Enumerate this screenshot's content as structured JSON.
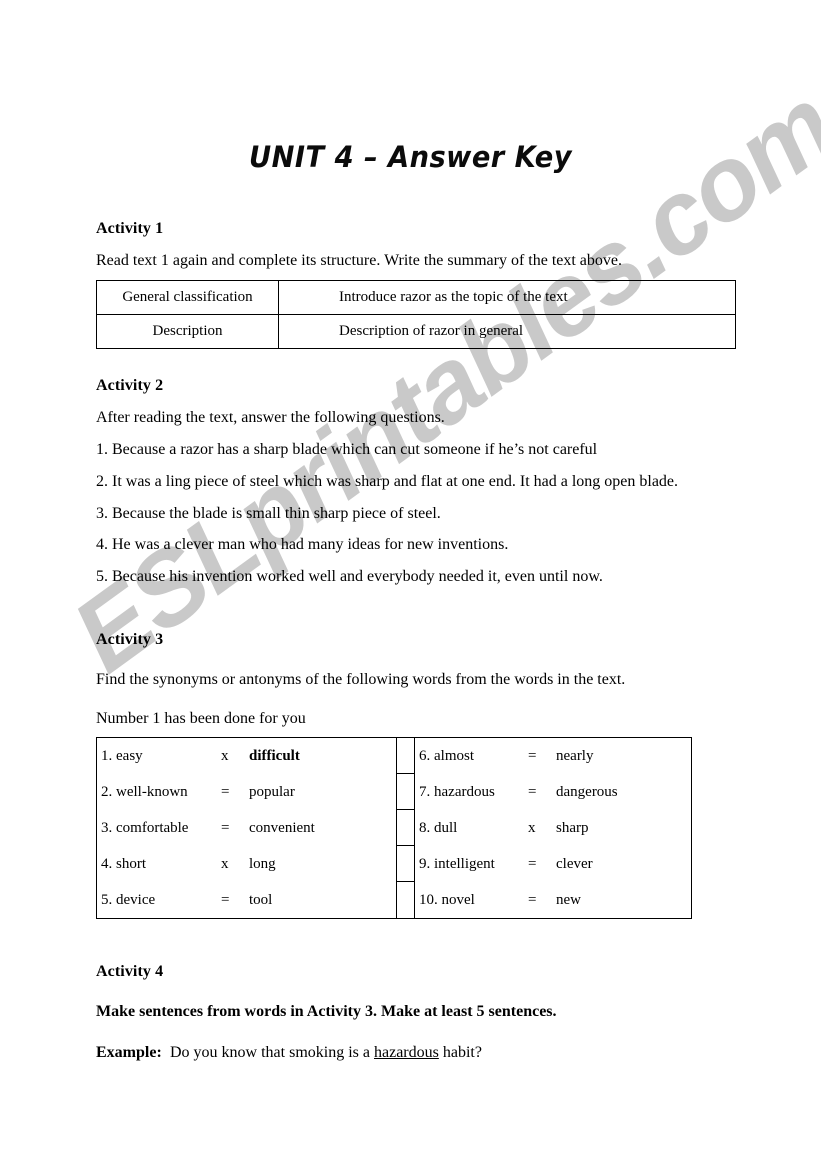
{
  "document": {
    "title": "UNIT 4 – Answer Key",
    "watermark": "ESLprintables.com"
  },
  "activity1": {
    "heading": "Activity 1",
    "instruction": "Read text 1 again and complete its structure. Write the summary of the text above.",
    "table": {
      "rows": [
        {
          "label": "General classification",
          "value": "Introduce razor as the topic of the text"
        },
        {
          "label": "Description",
          "value": "Description of razor in general"
        }
      ]
    }
  },
  "activity2": {
    "heading": "Activity 2",
    "instruction": "After reading the text, answer the following questions.",
    "answers": [
      "1. Because a razor has a sharp blade which can cut someone if he’s not careful",
      "2. It was a ling piece of steel which was sharp and flat at one end. It had a long open blade.",
      "3. Because the blade is small thin sharp piece of steel.",
      "4. He was a clever man who had many ideas for new inventions.",
      "5. Because his invention worked well and everybody needed it, even until now."
    ]
  },
  "activity3": {
    "heading": "Activity 3",
    "instruction": "Find the synonyms or antonyms of the following words from the words in the text.",
    "note": "Number 1 has been done for you",
    "left_column": [
      {
        "term": "1. easy",
        "symbol": "x",
        "answer": "difficult",
        "answer_bold": true
      },
      {
        "term": "2. well-known",
        "symbol": "=",
        "answer": "popular",
        "answer_bold": false
      },
      {
        "term": "3. comfortable",
        "symbol": "=",
        "answer": "convenient",
        "answer_bold": false
      },
      {
        "term": "4. short",
        "symbol": "x",
        "answer": "long",
        "answer_bold": false
      },
      {
        "term": "5. device",
        "symbol": "=",
        "answer": "tool",
        "answer_bold": false
      }
    ],
    "right_column": [
      {
        "term": "6. almost",
        "symbol": "=",
        "answer": "nearly",
        "answer_bold": false
      },
      {
        "term": "7. hazardous",
        "symbol": "=",
        "answer": "dangerous",
        "answer_bold": false
      },
      {
        "term": "8. dull",
        "symbol": "x",
        "answer": "sharp",
        "answer_bold": false
      },
      {
        "term": "9. intelligent",
        "symbol": "=",
        "answer": "clever",
        "answer_bold": false
      },
      {
        "term": "10. novel",
        "symbol": "=",
        "answer": "new",
        "answer_bold": false
      }
    ]
  },
  "activity4": {
    "heading": "Activity 4",
    "instruction": "Make sentences from words in Activity 3. Make at least 5 sentences.",
    "example_label": "Example:",
    "example_prefix": "Do you know that smoking is a ",
    "example_underlined": "hazardous",
    "example_suffix": " habit?"
  }
}
